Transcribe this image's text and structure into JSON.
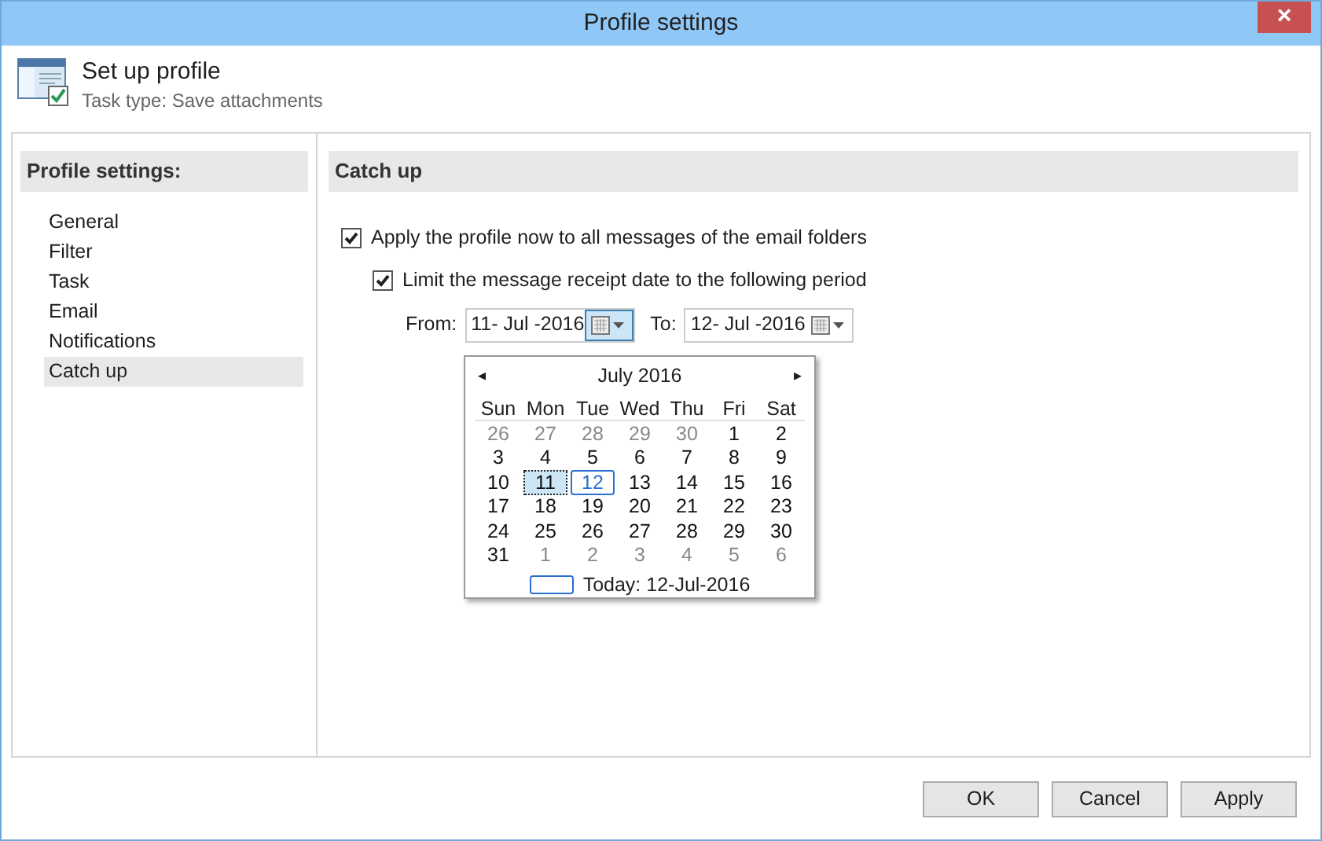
{
  "window": {
    "title": "Profile settings",
    "close": "×"
  },
  "header": {
    "title": "Set up profile",
    "subtitle": "Task type: Save attachments"
  },
  "sidebar": {
    "title": "Profile settings:",
    "items": [
      {
        "label": "General",
        "selected": false
      },
      {
        "label": "Filter",
        "selected": false
      },
      {
        "label": "Task",
        "selected": false
      },
      {
        "label": "Email",
        "selected": false
      },
      {
        "label": "Notifications",
        "selected": false
      },
      {
        "label": "Catch up",
        "selected": true
      }
    ]
  },
  "section": {
    "title": "Catch up",
    "options": [
      {
        "label": "Apply the profile now to all messages of the email folders",
        "checked": true
      },
      {
        "label": "Limit the message receipt date to the following period",
        "checked": true
      }
    ],
    "from": {
      "label": "From:",
      "value": "11- Jul -2016",
      "open": true
    },
    "to": {
      "label": "To:",
      "value": "12- Jul -2016",
      "open": false
    }
  },
  "calendar": {
    "month": "July 2016",
    "prev": "◂",
    "next": "▸",
    "weekdays": [
      "Sun",
      "Mon",
      "Tue",
      "Wed",
      "Thu",
      "Fri",
      "Sat"
    ],
    "weeks": [
      [
        {
          "day": "26",
          "other_month": true,
          "selected": false,
          "today": false
        },
        {
          "day": "27",
          "other_month": true,
          "selected": false,
          "today": false
        },
        {
          "day": "28",
          "other_month": true,
          "selected": false,
          "today": false
        },
        {
          "day": "29",
          "other_month": true,
          "selected": false,
          "today": false
        },
        {
          "day": "30",
          "other_month": true,
          "selected": false,
          "today": false
        },
        {
          "day": "1",
          "other_month": false,
          "selected": false,
          "today": false
        },
        {
          "day": "2",
          "other_month": false,
          "selected": false,
          "today": false
        }
      ],
      [
        {
          "day": "3",
          "other_month": false,
          "selected": false,
          "today": false
        },
        {
          "day": "4",
          "other_month": false,
          "selected": false,
          "today": false
        },
        {
          "day": "5",
          "other_month": false,
          "selected": false,
          "today": false
        },
        {
          "day": "6",
          "other_month": false,
          "selected": false,
          "today": false
        },
        {
          "day": "7",
          "other_month": false,
          "selected": false,
          "today": false
        },
        {
          "day": "8",
          "other_month": false,
          "selected": false,
          "today": false
        },
        {
          "day": "9",
          "other_month": false,
          "selected": false,
          "today": false
        }
      ],
      [
        {
          "day": "10",
          "other_month": false,
          "selected": false,
          "today": false
        },
        {
          "day": "11",
          "other_month": false,
          "selected": true,
          "today": false
        },
        {
          "day": "12",
          "other_month": false,
          "selected": false,
          "today": true
        },
        {
          "day": "13",
          "other_month": false,
          "selected": false,
          "today": false
        },
        {
          "day": "14",
          "other_month": false,
          "selected": false,
          "today": false
        },
        {
          "day": "15",
          "other_month": false,
          "selected": false,
          "today": false
        },
        {
          "day": "16",
          "other_month": false,
          "selected": false,
          "today": false
        }
      ],
      [
        {
          "day": "17",
          "other_month": false,
          "selected": false,
          "today": false
        },
        {
          "day": "18",
          "other_month": false,
          "selected": false,
          "today": false
        },
        {
          "day": "19",
          "other_month": false,
          "selected": false,
          "today": false
        },
        {
          "day": "20",
          "other_month": false,
          "selected": false,
          "today": false
        },
        {
          "day": "21",
          "other_month": false,
          "selected": false,
          "today": false
        },
        {
          "day": "22",
          "other_month": false,
          "selected": false,
          "today": false
        },
        {
          "day": "23",
          "other_month": false,
          "selected": false,
          "today": false
        }
      ],
      [
        {
          "day": "24",
          "other_month": false,
          "selected": false,
          "today": false
        },
        {
          "day": "25",
          "other_month": false,
          "selected": false,
          "today": false
        },
        {
          "day": "26",
          "other_month": false,
          "selected": false,
          "today": false
        },
        {
          "day": "27",
          "other_month": false,
          "selected": false,
          "today": false
        },
        {
          "day": "28",
          "other_month": false,
          "selected": false,
          "today": false
        },
        {
          "day": "29",
          "other_month": false,
          "selected": false,
          "today": false
        },
        {
          "day": "30",
          "other_month": false,
          "selected": false,
          "today": false
        }
      ],
      [
        {
          "day": "31",
          "other_month": false,
          "selected": false,
          "today": false
        },
        {
          "day": "1",
          "other_month": true,
          "selected": false,
          "today": false
        },
        {
          "day": "2",
          "other_month": true,
          "selected": false,
          "today": false
        },
        {
          "day": "3",
          "other_month": true,
          "selected": false,
          "today": false
        },
        {
          "day": "4",
          "other_month": true,
          "selected": false,
          "today": false
        },
        {
          "day": "5",
          "other_month": true,
          "selected": false,
          "today": false
        },
        {
          "day": "6",
          "other_month": true,
          "selected": false,
          "today": false
        }
      ]
    ],
    "today_label": "Today: 12-Jul-2016"
  },
  "buttons": [
    "OK",
    "Cancel",
    "Apply"
  ]
}
